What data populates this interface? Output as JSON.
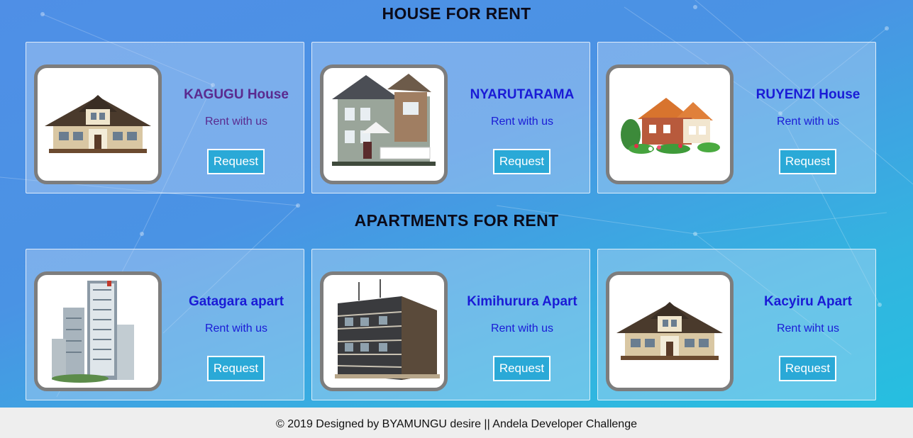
{
  "houses_section": {
    "title": "HOUSE FOR RENT",
    "cards": [
      {
        "name": "KAGUGU House",
        "subtitle": "Rent with us",
        "button": "Request",
        "image": "house-image"
      },
      {
        "name": "NYARUTARAMA",
        "subtitle": "Rent with us",
        "button": "Request",
        "image": "house-image"
      },
      {
        "name": "RUYENZI House",
        "subtitle": "Rent with us",
        "button": "Request",
        "image": "house-image"
      }
    ]
  },
  "apartments_section": {
    "title": "APARTMENTS FOR RENT",
    "cards": [
      {
        "name": "Gatagara apart",
        "subtitle": "Rent with us",
        "button": "Request",
        "image": "apartment-image"
      },
      {
        "name": "Kimihurura Apart",
        "subtitle": "Rent with us",
        "button": "Request",
        "image": "apartment-image"
      },
      {
        "name": "Kacyiru Apart",
        "subtitle": "Rent wiht us",
        "button": "Request",
        "image": "house-image"
      }
    ]
  },
  "footer": {
    "text": "© 2019 Designed by BYAMUNGU desire || Andela Developer Challenge"
  },
  "colors": {
    "link": "#1a1bd6",
    "visited_link": "#5a2a8f",
    "button_bg": "#2aa9d7",
    "footer_bg": "#eeeeee"
  }
}
